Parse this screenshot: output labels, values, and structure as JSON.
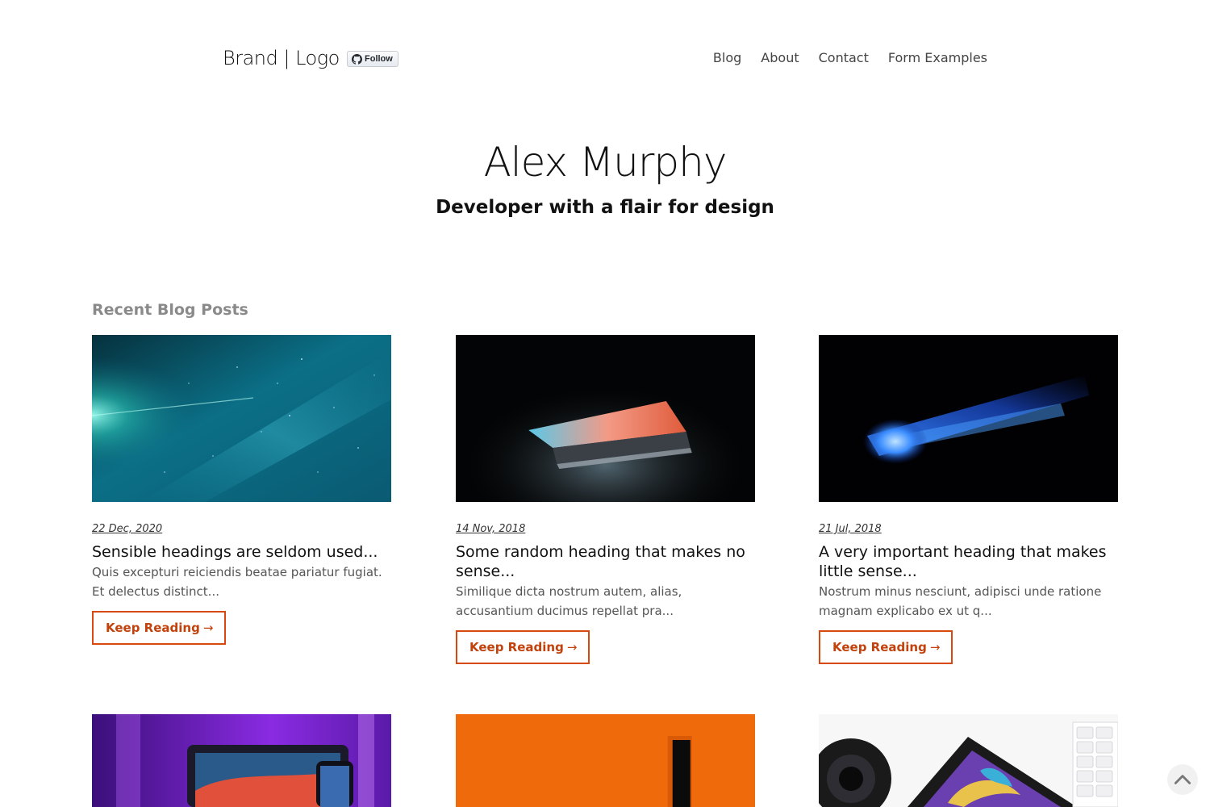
{
  "header": {
    "logo": "Brand | Logo",
    "github_follow_label": "Follow",
    "nav": [
      "Blog",
      "About",
      "Contact",
      "Form Examples"
    ]
  },
  "hero": {
    "name": "Alex Murphy",
    "tagline": "Developer with a flair for design"
  },
  "blog": {
    "section_title": "Recent Blog Posts",
    "button_label": "Keep Reading",
    "button_arrow": "→",
    "posts": [
      {
        "date": "22 Dec, 2020",
        "title": "Sensible headings are seldom used...",
        "excerpt": "Quis excepturi reiciendis beatae pariatur fugiat. Et delectus distinct...",
        "image": "night-sky-milky-way"
      },
      {
        "date": "14 Nov, 2018",
        "title": "Some random heading that makes no sense...",
        "excerpt": "Similique dicta nostrum autem, alias, accusantium ducimus repellat pra...",
        "image": "glowing-laptop-dark"
      },
      {
        "date": "21 Jul, 2018",
        "title": "A very important heading that makes little sense...",
        "excerpt": "Nostrum minus nesciunt, adipisci unde ratione magnam explicabo ex ut q...",
        "image": "blue-light-streak"
      },
      {
        "image": "purple-desk-devices"
      },
      {
        "image": "orange-wall-doorway"
      },
      {
        "image": "phone-camera-lens-keyboard"
      }
    ]
  },
  "colors": {
    "accent": "#d9480f",
    "section_title": "#8a8a8a"
  }
}
